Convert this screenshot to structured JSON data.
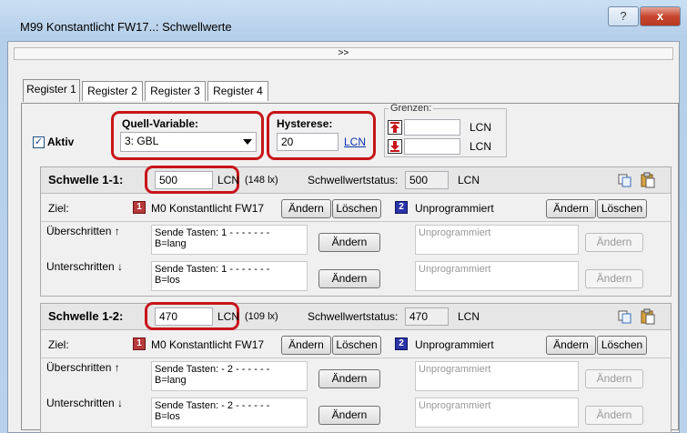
{
  "window": {
    "title": "M99 Konstantlicht FW17..: Schwellwerte",
    "help_label": "?",
    "close_label": "x"
  },
  "collapse_label": ">>",
  "tabs": [
    "Register 1",
    "Register 2",
    "Register 3",
    "Register 4"
  ],
  "aktiv": {
    "label": "Aktiv",
    "checked": true
  },
  "quell": {
    "label": "Quell-Variable:",
    "value": "3: GBL"
  },
  "hysterese": {
    "label": "Hysterese:",
    "value": "20",
    "unit": "LCN"
  },
  "grenzen": {
    "label": "Grenzen:",
    "upper_unit": "LCN",
    "lower_unit": "LCN",
    "upper_value": "",
    "lower_value": ""
  },
  "schwellen": [
    {
      "title": "Schwelle 1-1:",
      "value": "500",
      "unit": "LCN",
      "lux": "(148 lx)",
      "status_label": "Schwellwertstatus:",
      "status_value": "500",
      "status_unit": "LCN",
      "ziel_label": "Ziel:",
      "target1_num": "1",
      "target1": "M0 Konstantlicht FW17",
      "target2_num": "2",
      "target2": "Unprogrammiert",
      "aendern": "Ändern",
      "loeschen": "Löschen",
      "over_label": "Überschritten ↑",
      "over_cmd": "Sende Tasten: 1 - - - - - - -\nB=lang",
      "over_unprog": "Unprogrammiert",
      "under_label": "Unterschritten ↓",
      "under_cmd": "Sende Tasten: 1 - - - - - - -\nB=los",
      "under_unprog": "Unprogrammiert"
    },
    {
      "title": "Schwelle 1-2:",
      "value": "470",
      "unit": "LCN",
      "lux": "(109 lx)",
      "status_label": "Schwellwertstatus:",
      "status_value": "470",
      "status_unit": "LCN",
      "ziel_label": "Ziel:",
      "target1_num": "1",
      "target1": "M0 Konstantlicht FW17",
      "target2_num": "2",
      "target2": "Unprogrammiert",
      "aendern": "Ändern",
      "loeschen": "Löschen",
      "over_label": "Überschritten ↑",
      "over_cmd": "Sende Tasten: - 2 - - - - - -\nB=lang",
      "over_unprog": "Unprogrammiert",
      "under_label": "Unterschritten ↓",
      "under_cmd": "Sende Tasten: - 2 - - - - - -\nB=los",
      "under_unprog": "Unprogrammiert"
    }
  ],
  "icons": {
    "copy": "copy-icon",
    "paste": "paste-icon",
    "up": "limit-up-icon",
    "down": "limit-down-icon"
  },
  "colors": {
    "highlight": "#c8141a",
    "badge1": "#b73b3b",
    "badge2": "#2b33a8"
  }
}
